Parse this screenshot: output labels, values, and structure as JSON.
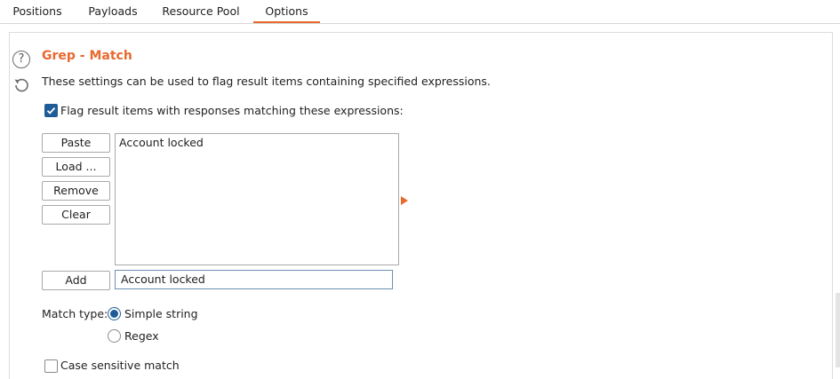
{
  "tabs": [
    {
      "label": "Positions"
    },
    {
      "label": "Payloads"
    },
    {
      "label": "Resource Pool"
    },
    {
      "label": "Options"
    }
  ],
  "active_tab": "Options",
  "section": {
    "title": "Grep - Match",
    "description": "These settings can be used to flag result items containing specified expressions.",
    "help_icon": "question-icon",
    "reset_icon": "restore-icon"
  },
  "flag_checkbox": {
    "label": "Flag result items with responses matching these expressions:",
    "checked": true
  },
  "buttons": {
    "paste": "Paste",
    "load": "Load ...",
    "remove": "Remove",
    "clear": "Clear",
    "add": "Add"
  },
  "expressions": [
    "Account locked"
  ],
  "add_input": {
    "value": "Account locked"
  },
  "match_type": {
    "label": "Match type:",
    "options": [
      "Simple string",
      "Regex"
    ],
    "selected": "Simple string"
  },
  "case_sensitive": {
    "label": "Case sensitive match",
    "checked": false
  },
  "colors": {
    "accent": "#e8692e",
    "checkbox": "#1f5b96"
  }
}
